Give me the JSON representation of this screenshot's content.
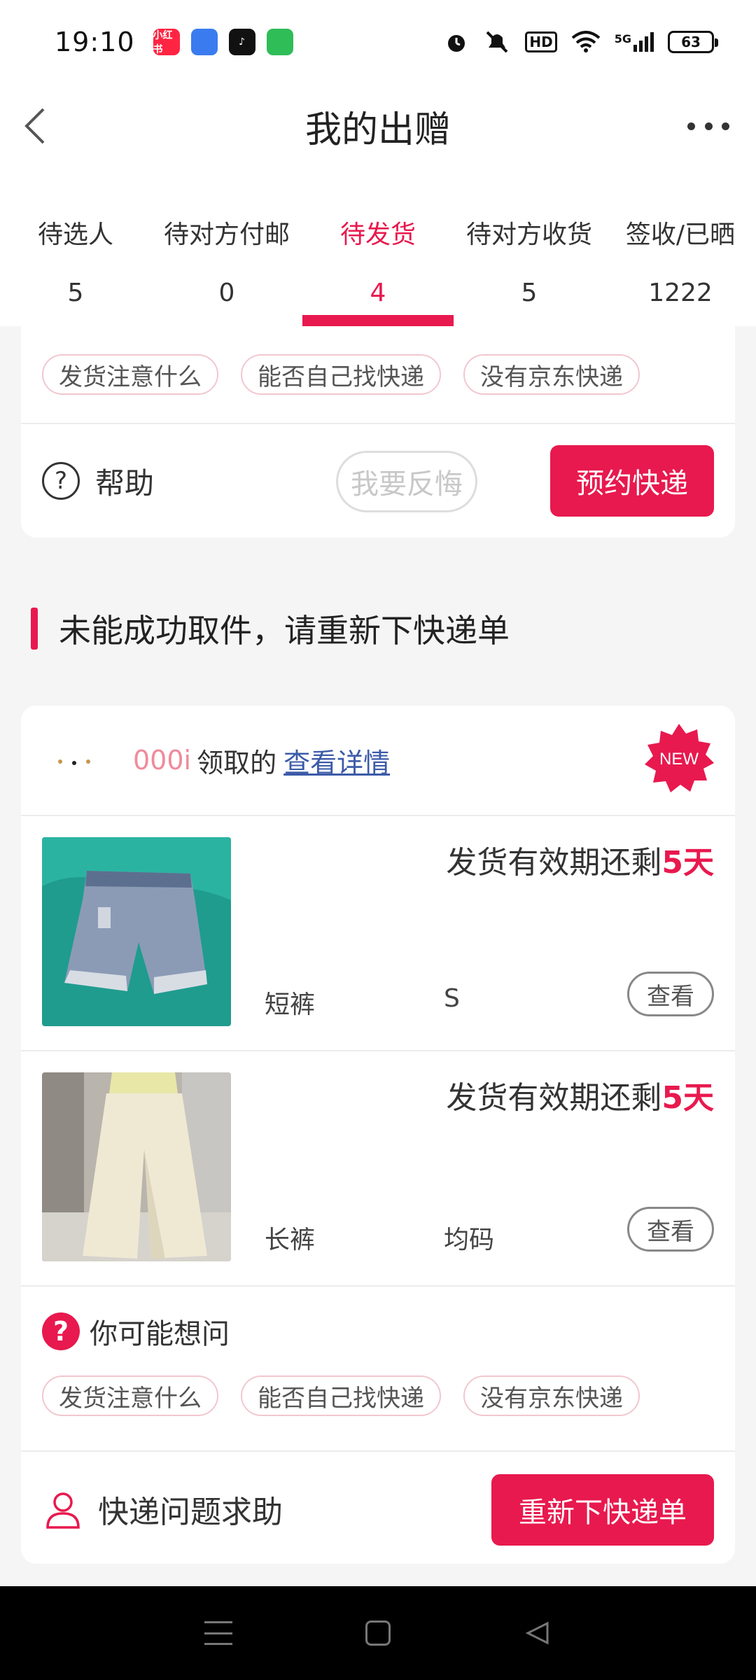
{
  "status_bar": {
    "time": "19:10",
    "apps": [
      {
        "name": "xiaohongshu-app-icon",
        "text": "小红书",
        "color": "#ff2442"
      },
      {
        "name": "feather-app-icon",
        "text": "",
        "color": "#3a7cf0"
      },
      {
        "name": "tiktok-app-icon",
        "text": "♪",
        "color": "#111111"
      },
      {
        "name": "android-app-icon",
        "text": "",
        "color": "#2fbd58"
      }
    ],
    "hd": "HD",
    "network": "5G",
    "battery": "63"
  },
  "header": {
    "title": "我的出赠"
  },
  "tabs": [
    {
      "label": "待选人",
      "count": "5"
    },
    {
      "label": "待对方付邮",
      "count": "0"
    },
    {
      "label": "待发货",
      "count": "4"
    },
    {
      "label": "待对方收货",
      "count": "5"
    },
    {
      "label": "签收/已晒",
      "count": "1222"
    }
  ],
  "top_card": {
    "chips": [
      "发货注意什么",
      "能否自己找快递",
      "没有京东快递"
    ],
    "help_label": "帮助",
    "regret_button": "我要反悔",
    "book_button": "预约快递"
  },
  "section": {
    "title": "未能成功取件，请重新下快递单"
  },
  "order_card": {
    "recipient": "000i",
    "recipient_suffix": "领取的",
    "details_link": "查看详情",
    "new_badge": "NEW",
    "items": [
      {
        "deadline_prefix": "发货有效期还剩",
        "deadline_days": "5天",
        "name": "短裤",
        "size": "S",
        "view_button": "查看"
      },
      {
        "deadline_prefix": "发货有效期还剩",
        "deadline_days": "5天",
        "name": "长裤",
        "size": "均码",
        "view_button": "查看"
      }
    ],
    "faq_label": "你可能想问",
    "chips": [
      "发货注意什么",
      "能否自己找快递",
      "没有京东快递"
    ],
    "contact_label": "快递问题求助",
    "reorder_button": "重新下快递单"
  },
  "colors": {
    "accent": "#e8194e",
    "link": "#3c5ba8"
  }
}
